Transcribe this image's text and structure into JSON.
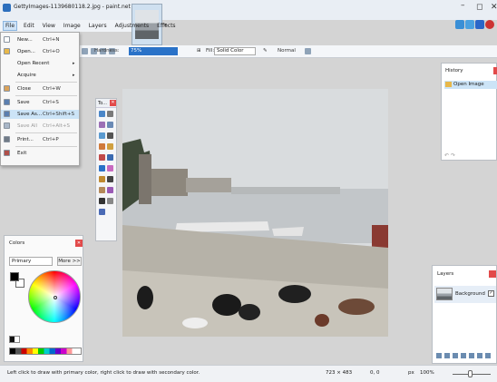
{
  "window": {
    "title": "GettyImages-1139680118.2.jpg - paint.net 4.2",
    "minimize_glyph": "–",
    "maximize_glyph": "◻",
    "close_glyph": "✕"
  },
  "menubar": {
    "items": [
      "File",
      "Edit",
      "View",
      "Image",
      "Layers",
      "Adjustments",
      "Effects"
    ]
  },
  "toolbar": {
    "hardness_label": "Hardness:",
    "hardness_value": "75%",
    "fill_label": "Fill:",
    "fill_value": "Solid Color",
    "blend_value": "Normal"
  },
  "file_menu": {
    "items": [
      {
        "label": "New...",
        "shortcut": "Ctrl+N",
        "icon": "new-file-icon",
        "color": "#ffffff",
        "disabled": false,
        "highlighted": false,
        "submenu": false
      },
      {
        "label": "Open...",
        "shortcut": "Ctrl+O",
        "icon": "open-folder-icon",
        "color": "#e8b84a",
        "disabled": false,
        "highlighted": false,
        "submenu": false
      },
      {
        "label": "Open Recent",
        "shortcut": "",
        "icon": "",
        "color": "",
        "disabled": false,
        "highlighted": false,
        "submenu": true
      },
      {
        "label": "Acquire",
        "shortcut": "",
        "icon": "",
        "color": "",
        "disabled": false,
        "highlighted": false,
        "submenu": true
      },
      {
        "label": "Close",
        "shortcut": "Ctrl+W",
        "icon": "close-doc-icon",
        "color": "#d9a25a",
        "disabled": false,
        "highlighted": false,
        "submenu": false
      },
      {
        "label": "Save",
        "shortcut": "Ctrl+S",
        "icon": "save-icon",
        "color": "#5b7fb0",
        "disabled": false,
        "highlighted": false,
        "submenu": false
      },
      {
        "label": "Save As...",
        "shortcut": "Ctrl+Shift+S",
        "icon": "save-as-icon",
        "color": "#5b7fb0",
        "disabled": false,
        "highlighted": true,
        "submenu": false
      },
      {
        "label": "Save All",
        "shortcut": "Ctrl+Alt+S",
        "icon": "save-all-icon",
        "color": "#a9b7c8",
        "disabled": true,
        "highlighted": false,
        "submenu": false
      },
      {
        "label": "Print...",
        "shortcut": "Ctrl+P",
        "icon": "print-icon",
        "color": "#707a86",
        "disabled": false,
        "highlighted": false,
        "submenu": false
      },
      {
        "label": "Exit",
        "shortcut": "",
        "icon": "exit-icon",
        "color": "#b0504a",
        "disabled": false,
        "highlighted": false,
        "submenu": false
      }
    ]
  },
  "tools_panel": {
    "title": "To...",
    "close_glyph": "✕"
  },
  "colors_panel": {
    "title": "Colors",
    "close_glyph": "✕",
    "primary_select": "Primary",
    "more_button": "More >>"
  },
  "history_panel": {
    "title": "History",
    "items": [
      "Open Image"
    ],
    "undo_glyph": "↶",
    "redo_glyph": "↷"
  },
  "layers_panel": {
    "title": "Layers",
    "layer_name": "Background",
    "visible_glyph": "✓"
  },
  "statusbar": {
    "hint": "Left click to draw with primary color, right click to draw with secondary color.",
    "image_size": "723 × 483",
    "cursor_pos": "0, 0",
    "units": "px",
    "zoom": "100%"
  },
  "colors": {
    "accent": "#2a72c8",
    "close_red": "#e24a4a",
    "highlight": "#cce4f7"
  }
}
